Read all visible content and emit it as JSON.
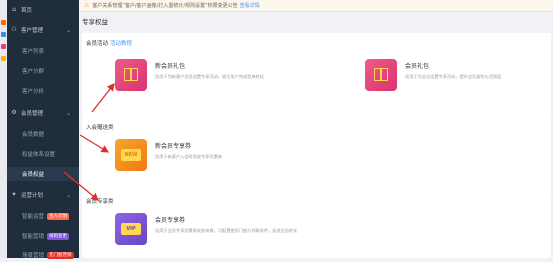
{
  "notice": {
    "text": "客户关系管理“客户/客户画像/打入墨统计/规则设置”权限变更公告",
    "link": "查看详情"
  },
  "sidebar": {
    "items": [
      {
        "label": "首页"
      },
      {
        "label": "客户管理"
      },
      {
        "label": "客户列表"
      },
      {
        "label": "客户分群"
      },
      {
        "label": "客户分析"
      },
      {
        "label": "会员管理"
      },
      {
        "label": "会员数据"
      },
      {
        "label": "权益体系设置"
      },
      {
        "label": "会员权益"
      },
      {
        "label": "运营计划"
      },
      {
        "label": "智能运营",
        "badge": "主人计划"
      },
      {
        "label": "智能营销",
        "badge": "规则变更"
      },
      {
        "label": "场景营销",
        "badge": "无门槛营销"
      }
    ]
  },
  "main": {
    "title": "专享权益",
    "section1": {
      "title": "会员活动",
      "link": "活动教程",
      "cards": [
        {
          "name": "新会员礼包",
          "desc": "适用于为新客户会员设置专享活动，吸引用户完成首单转化"
        },
        {
          "name": "会员礼包",
          "desc": "适用于为会员设置专享活动，提升会员复购与活跃度"
        }
      ]
    },
    "section2": {
      "title": "入会赠送类",
      "cards": [
        {
          "name": "新会员专享券",
          "desc": "适用于新客户入会时发放专享优惠券",
          "icon_text": "NEW"
        }
      ]
    },
    "section3": {
      "title": "会员专享类",
      "cards": [
        {
          "name": "会员专享券",
          "desc": "适用于会员专享优惠券发放场景，可配置使用门槛与领取条件，促进会员转化",
          "icon_text": "VIP"
        }
      ]
    }
  },
  "colors": {
    "sidebar_bg": "#1f2d3d",
    "link": "#409eff",
    "arrow": "#e0302a",
    "gift_pink": "#e6417a",
    "coupon_orange": "#f48a1f",
    "coupon_purple": "#7b55d6"
  }
}
